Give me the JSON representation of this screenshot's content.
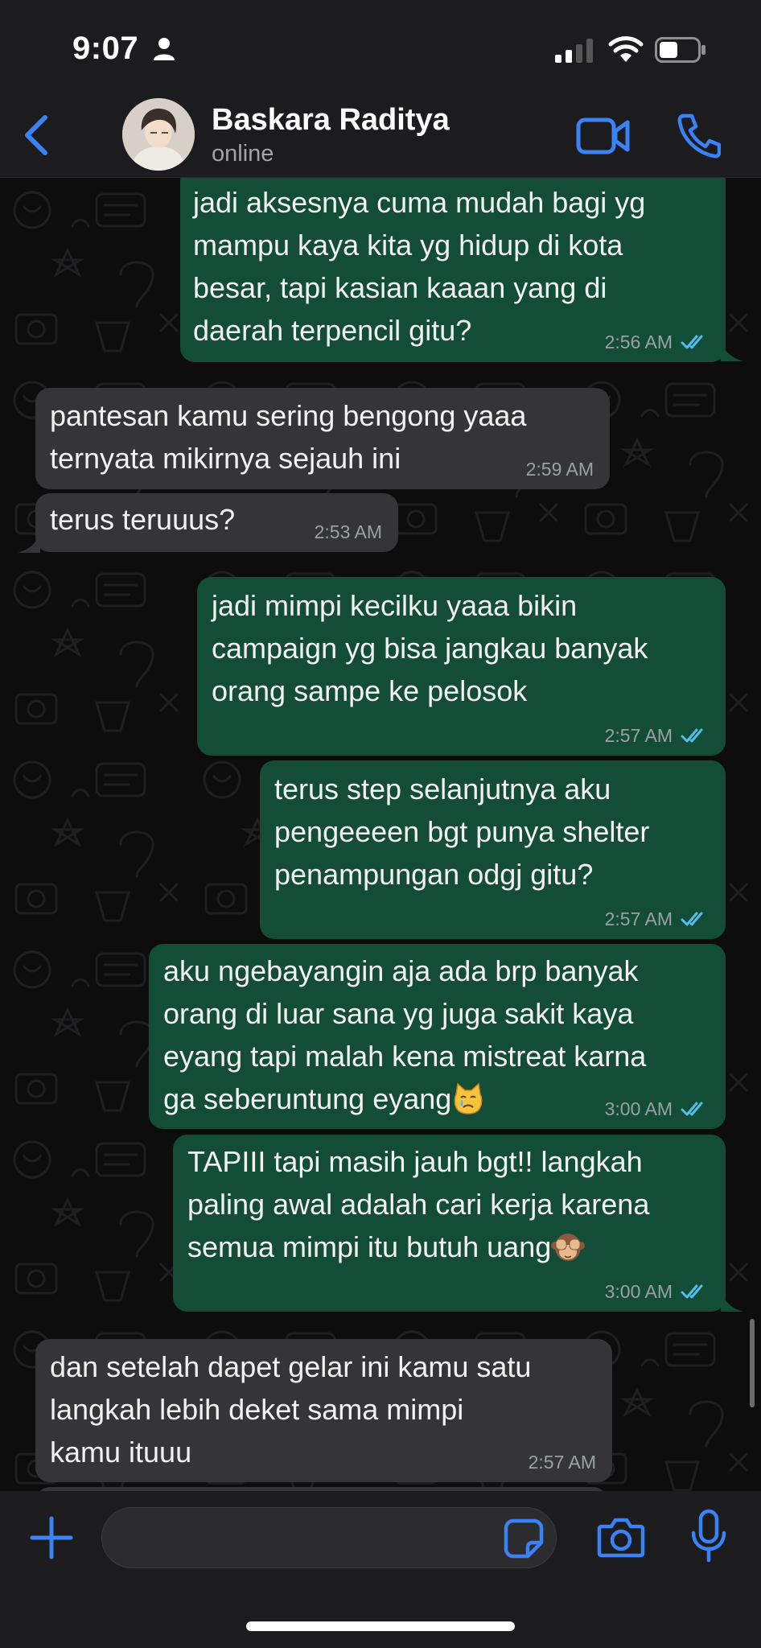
{
  "status_bar": {
    "time": "9:07",
    "person_icon": "person-icon",
    "signal_icon": "cellular-signal-icon",
    "wifi_icon": "wifi-icon",
    "battery_icon": "battery-icon"
  },
  "header": {
    "back_icon": "chevron-left-icon",
    "contact_name": "Baskara Raditya",
    "contact_status": "online",
    "video_icon": "video-call-icon",
    "call_icon": "phone-icon"
  },
  "messages": [
    {
      "direction": "out",
      "text": "jadi aksesnya cuma mudah bagi yg\nmampu kaya kita yg hidup di kota\nbesar, tapi kasian kaaan yang di\ndaerah terpencil gitu?",
      "time": "2:56 AM",
      "status": "read"
    },
    {
      "direction": "in",
      "text": "pantesan kamu sering bengong yaaa\nternyata mikirnya sejauh ini",
      "time": "2:59 AM"
    },
    {
      "direction": "in",
      "text": "terus teruuus?",
      "time": "2:53 AM"
    },
    {
      "direction": "out",
      "text": "jadi mimpi kecilku yaaa bikin\ncampaign yg bisa jangkau banyak\norang sampe ke pelosok",
      "time": "2:57 AM",
      "status": "read"
    },
    {
      "direction": "out",
      "text": "terus step selanjutnya aku\npengeeeen bgt punya shelter\npenampungan odgj gitu?",
      "time": "2:57 AM",
      "status": "read"
    },
    {
      "direction": "out",
      "text": "aku ngebayangin aja ada brp banyak\norang di luar sana yg juga sakit kaya\neyang tapi malah kena mistreat karna\nga seberuntung eyang",
      "emoji": "crying-cat-emoji",
      "time": "3:00 AM",
      "status": "read"
    },
    {
      "direction": "out",
      "text": "TAPIII tapi masih jauh bgt!! langkah\npaling awal adalah cari kerja karena\nsemua mimpi itu butuh uang",
      "emoji": "see-no-evil-monkey-emoji",
      "time": "3:00 AM",
      "status": "read"
    },
    {
      "direction": "in",
      "text": "dan setelah dapet gelar ini kamu satu\nlangkah lebih deket sama mimpi\nkamu ituuu",
      "time": "2:57 AM"
    }
  ],
  "input_bar": {
    "plus_icon": "plus-icon",
    "placeholder": "",
    "sticker_icon": "sticker-icon",
    "camera_icon": "camera-icon",
    "mic_icon": "microphone-icon"
  },
  "colors": {
    "accent": "#3b82f6",
    "outgoing_bubble": "#144d37",
    "incoming_bubble": "#353537",
    "read_ticks": "#53bdeb",
    "bar_background": "#1c1c1e"
  }
}
